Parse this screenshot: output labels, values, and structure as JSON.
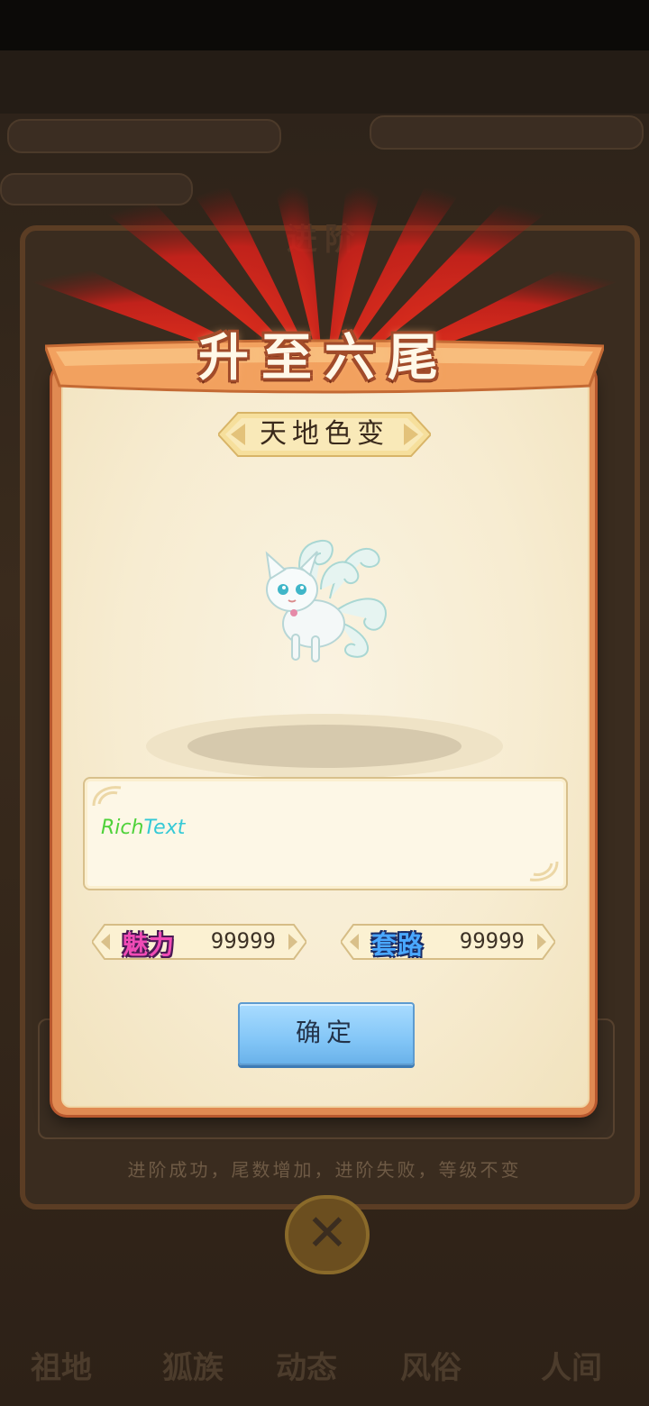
{
  "dialog": {
    "title": "升至六尾",
    "subtitle": "天地色变",
    "description": {
      "part1": "Rich",
      "part2": "Text"
    },
    "stats": [
      {
        "label": "魅力",
        "value": "99999"
      },
      {
        "label": "套路",
        "value": "99999"
      }
    ],
    "confirm_label": "确定"
  },
  "background": {
    "panel_title": "进阶",
    "hint": "进阶成功，尾数增加，进阶失败，等级不变",
    "close_label": "✕",
    "tabs": [
      "祖地",
      "狐族",
      "动态",
      "风俗",
      "人间"
    ]
  },
  "colors": {
    "dialog_frame": "#e08a52",
    "dialog_body": "#f7ecd1",
    "stat_charm": "#f04bb5",
    "stat_trick": "#4aa8ff",
    "confirm_button": "#83c6f7"
  }
}
